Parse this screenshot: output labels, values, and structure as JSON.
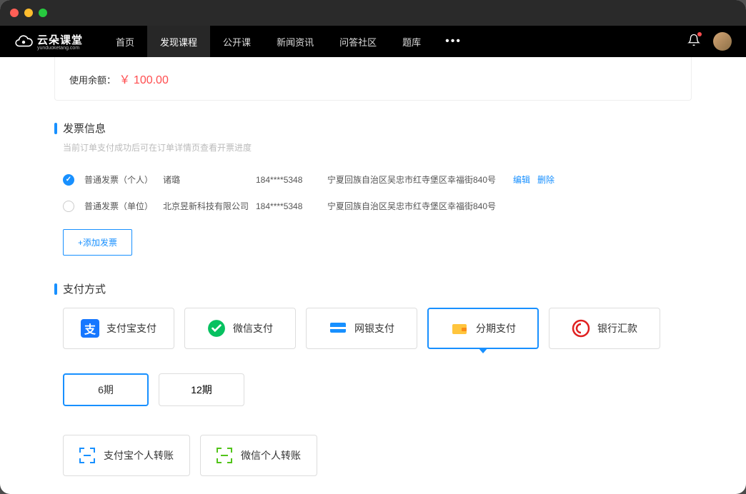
{
  "brand": {
    "name": "云朵课堂",
    "sub": "yunduoketang.com"
  },
  "nav": {
    "items": [
      "首页",
      "发现课程",
      "公开课",
      "新闻资讯",
      "问答社区",
      "题库"
    ],
    "activeIndex": 1
  },
  "balance": {
    "label": "使用余额：",
    "value": "￥ 100.00"
  },
  "invoice": {
    "title": "发票信息",
    "desc": "当前订单支付成功后可在订单详情页查看开票进度",
    "rows": [
      {
        "type": "普通发票（个人）",
        "name": "诸璐",
        "phone": "184****5348",
        "addr": "宁夏回族自治区吴忠市红寺堡区幸福街840号",
        "checked": true,
        "showActions": true
      },
      {
        "type": "普通发票（单位）",
        "name": "北京昱新科技有限公司",
        "phone": "184****5348",
        "addr": "宁夏回族自治区吴忠市红寺堡区幸福街840号",
        "checked": false,
        "showActions": false
      }
    ],
    "editLabel": "编辑",
    "deleteLabel": "删除",
    "addLabel": "+添加发票"
  },
  "payment": {
    "title": "支付方式",
    "methods": [
      {
        "label": "支付宝支付",
        "icon": "alipay"
      },
      {
        "label": "微信支付",
        "icon": "wechat"
      },
      {
        "label": "网银支付",
        "icon": "unionpay"
      },
      {
        "label": "分期支付",
        "icon": "wallet",
        "selected": true
      },
      {
        "label": "银行汇款",
        "icon": "bank"
      }
    ],
    "installments": [
      {
        "label": "6期",
        "selected": true
      },
      {
        "label": "12期",
        "selected": false
      }
    ],
    "transfers": [
      {
        "label": "支付宝个人转账",
        "color": "#1890ff"
      },
      {
        "label": "微信个人转账",
        "color": "#52c41a"
      }
    ]
  }
}
